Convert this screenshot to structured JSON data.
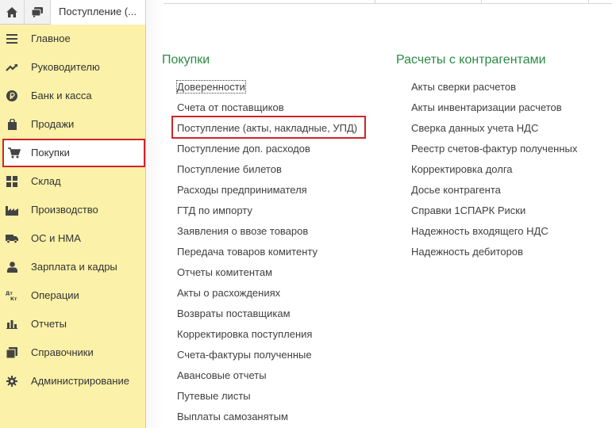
{
  "topbar": {
    "home_icon": "home-icon",
    "chat_icon": "chat-icon",
    "tab_label": "Поступление (..."
  },
  "sidebar": {
    "items": [
      {
        "label": "Главное",
        "icon": "menu-lines-icon"
      },
      {
        "label": "Руководителю",
        "icon": "trend-icon"
      },
      {
        "label": "Банк и касса",
        "icon": "ruble-icon"
      },
      {
        "label": "Продажи",
        "icon": "bag-icon"
      },
      {
        "label": "Покупки",
        "icon": "cart-icon",
        "selected": true
      },
      {
        "label": "Склад",
        "icon": "grid-icon"
      },
      {
        "label": "Производство",
        "icon": "factory-icon"
      },
      {
        "label": "ОС и НМА",
        "icon": "truck-icon"
      },
      {
        "label": "Зарплата и кадры",
        "icon": "person-icon"
      },
      {
        "label": "Операции",
        "icon": "dt-kt-icon"
      },
      {
        "label": "Отчеты",
        "icon": "bar-chart-icon"
      },
      {
        "label": "Справочники",
        "icon": "books-icon"
      },
      {
        "label": "Администрирование",
        "icon": "gear-icon"
      }
    ]
  },
  "purchases": {
    "title": "Покупки",
    "links": [
      "Доверенности",
      "Счета от поставщиков",
      "Поступление (акты, накладные, УПД)",
      "Поступление доп. расходов",
      "Поступление билетов",
      "Расходы предпринимателя",
      "ГТД по импорту",
      "Заявления о ввозе товаров",
      "Передача товаров комитенту",
      "Отчеты комитентам",
      "Акты о расхождениях",
      "Возвраты поставщикам",
      "Корректировка поступления",
      "Счета-фактуры полученные",
      "Авансовые отчеты",
      "Путевые листы",
      "Выплаты самозанятым"
    ]
  },
  "settlements": {
    "title": "Расчеты с контрагентами",
    "links": [
      "Акты сверки расчетов",
      "Акты инвентаризации расчетов",
      "Сверка данных учета НДС",
      "Реестр счетов-фактур полученных",
      "Корректировка долга",
      "Досье контрагента",
      "Справки 1СПАРК Риски",
      "Надежность входящего НДС",
      "Надежность дебиторов"
    ]
  },
  "colors": {
    "sidebar_bg": "#fbf1a8",
    "title_green": "#2c8a45",
    "highlight_red": "#d2232a"
  }
}
